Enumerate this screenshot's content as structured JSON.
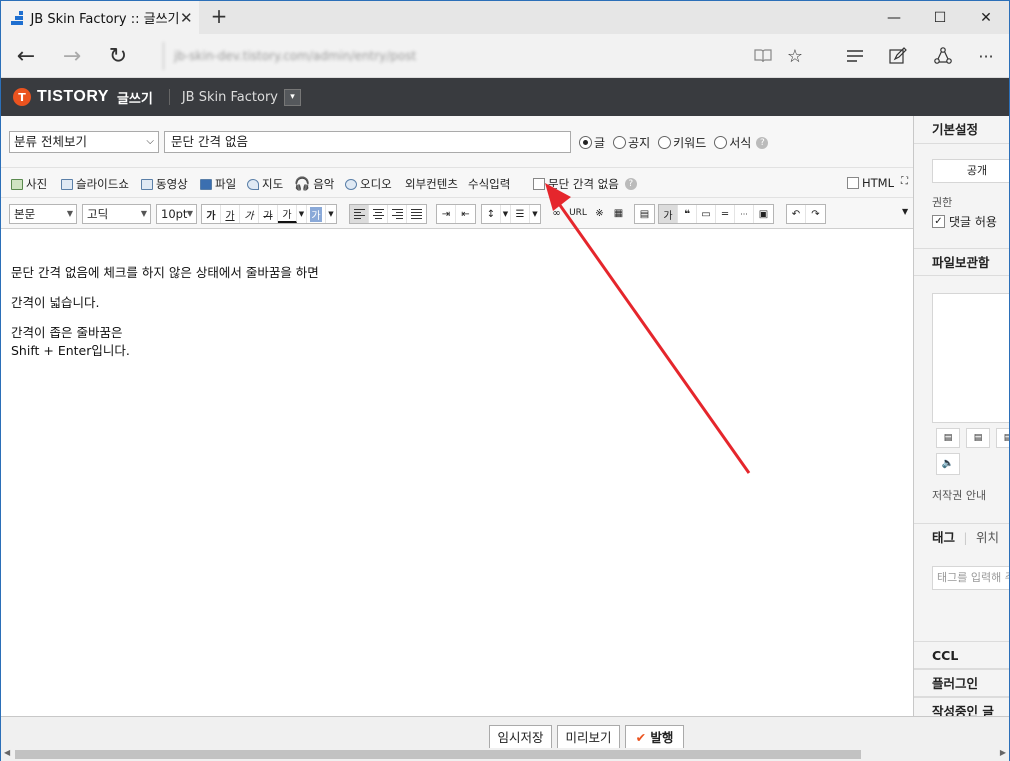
{
  "browser": {
    "tab_title": "JB Skin Factory :: 글쓰기",
    "url": "jb-skin-dev.tistory.com/admin/entry/post"
  },
  "header": {
    "logo": "TISTORY",
    "mode": "글쓰기",
    "blog_name": "JB Skin Factory"
  },
  "post": {
    "category": "분류 전체보기",
    "title": "문단 간격 없음",
    "types": [
      "글",
      "공지",
      "키워드",
      "서식"
    ],
    "selected_type": "글"
  },
  "attach_bar": {
    "items": [
      "사진",
      "슬라이드쇼",
      "동영상",
      "파일",
      "지도",
      "음악",
      "오디오",
      "외부컨텐츠",
      "수식입력"
    ],
    "no_spacing_label": "문단 간격 없음",
    "html_label": "HTML"
  },
  "format_bar": {
    "paragraph": "본문",
    "font": "고딕",
    "size": "10pt",
    "url_label": "URL"
  },
  "content": {
    "p1": "문단 간격 없음에 체크를 하지 않은 상태에서 줄바꿈을 하면",
    "p2": "간격이 넓습니다.",
    "p3_line1": "간격이 좁은 줄바꿈은",
    "p3_line2": "Shift + Enter입니다."
  },
  "bottom": {
    "draft": "임시저장",
    "preview": "미리보기",
    "publish": "발행"
  },
  "sidebar": {
    "basic": "기본설정",
    "public_btn": "공개",
    "permission": "권한",
    "comment_allow": "댓글 허용",
    "files": "파일보관함",
    "copyright": "저작권 안내",
    "tag_tab": "태그",
    "location_tab": "위치",
    "tag_placeholder": "태그를 입력해 주",
    "ccl": "CCL",
    "plugin": "플러그인",
    "writing": "작성중인 글"
  },
  "colors": {
    "header_bg": "#393b3f",
    "brand": "#eb531f",
    "annotation_arrow": "#e5262c"
  }
}
